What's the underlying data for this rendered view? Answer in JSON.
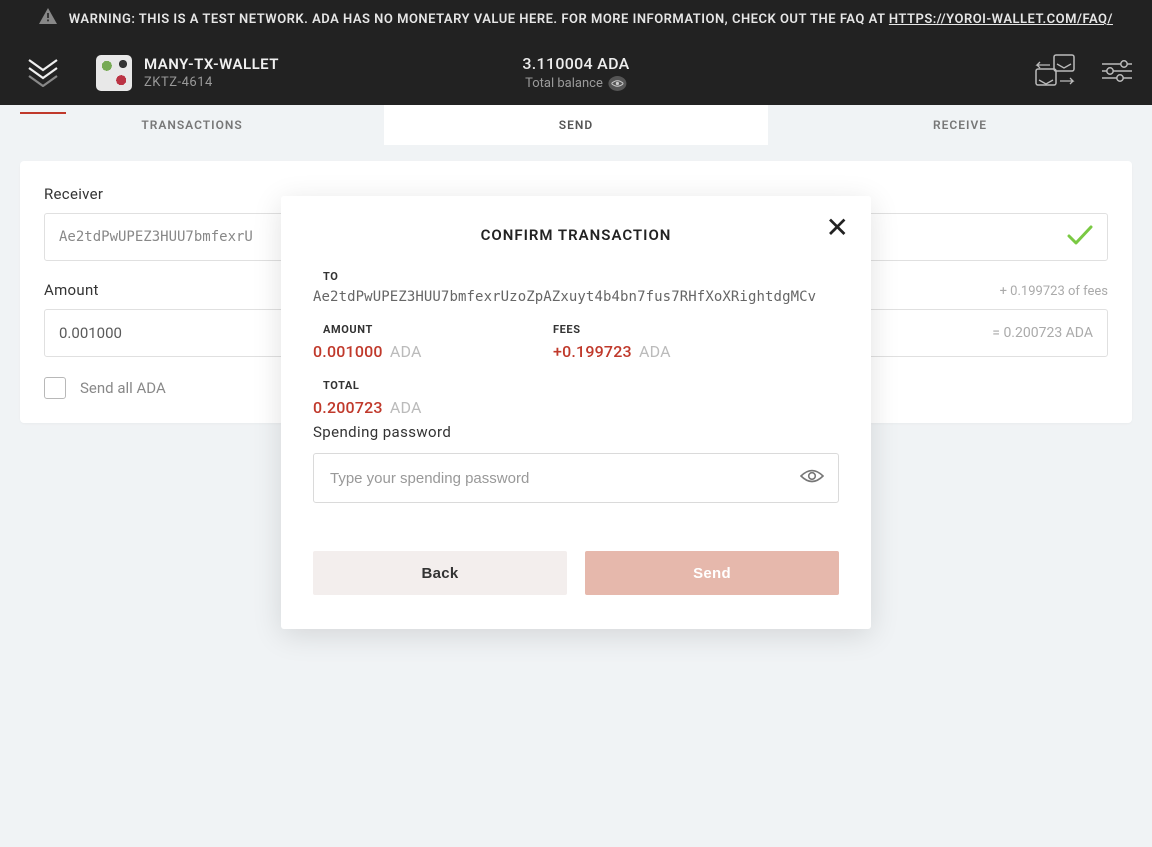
{
  "warning": {
    "prefix": "WARNING: THIS IS A TEST NETWORK. ADA HAS NO MONETARY VALUE HERE. FOR MORE INFORMATION, CHECK OUT THE FAQ AT ",
    "link": "HTTPS://YOROI-WALLET.COM/FAQ/"
  },
  "wallet": {
    "name": "MANY-TX-WALLET",
    "code": "ZKTZ-4614"
  },
  "balance": {
    "amount": "3.110004 ADA",
    "label": "Total balance"
  },
  "tabs": {
    "transactions": "TRANSACTIONS",
    "send": "SEND",
    "receive": "RECEIVE"
  },
  "send_form": {
    "receiver_label": "Receiver",
    "receiver_value": "Ae2tdPwUPEZ3HUU7bmfexrU",
    "amount_label": "Amount",
    "fee_hint": "+ 0.199723 of fees",
    "amount_value": "0.001000",
    "amount_computed": "= 0.200723 ADA",
    "send_all_label": "Send all ADA"
  },
  "modal": {
    "title": "CONFIRM TRANSACTION",
    "to_label": "TO",
    "to_value": "Ae2tdPwUPEZ3HUU7bmfexrUzoZpAZxuyt4b4bn7fus7RHfXoXRightdgMCv",
    "amount_label": "AMOUNT",
    "amount_num": "0.001000",
    "amount_cur": "ADA",
    "fees_label": "FEES",
    "fees_num": "+0.199723",
    "fees_cur": "ADA",
    "total_label": "TOTAL",
    "total_num": "0.200723",
    "total_cur": "ADA",
    "pw_label": "Spending password",
    "pw_placeholder": "Type your spending password",
    "back_label": "Back",
    "send_label": "Send"
  }
}
